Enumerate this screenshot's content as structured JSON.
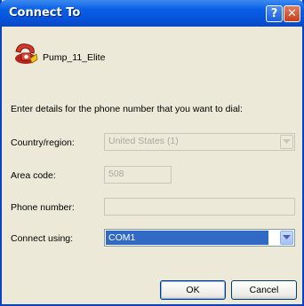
{
  "window": {
    "title": "Connect To"
  },
  "titlebar": {
    "help_label": "?",
    "close_label": "✕"
  },
  "connection": {
    "name": "Pump_11_Elite",
    "icon": "phone-icon"
  },
  "instructions": "Enter details for the phone number that you want to dial:",
  "form": {
    "country_label": "Country/region:",
    "country_value": "United States (1)",
    "area_code_label": "Area code:",
    "area_code_value": "508",
    "phone_label": "Phone number:",
    "phone_value": "",
    "connect_label": "Connect using:",
    "connect_value": "COM1"
  },
  "buttons": {
    "ok": "OK",
    "cancel": "Cancel"
  },
  "colors": {
    "accent": "#0a5fe6",
    "selection": "#316ac5",
    "close": "#c4401c"
  }
}
